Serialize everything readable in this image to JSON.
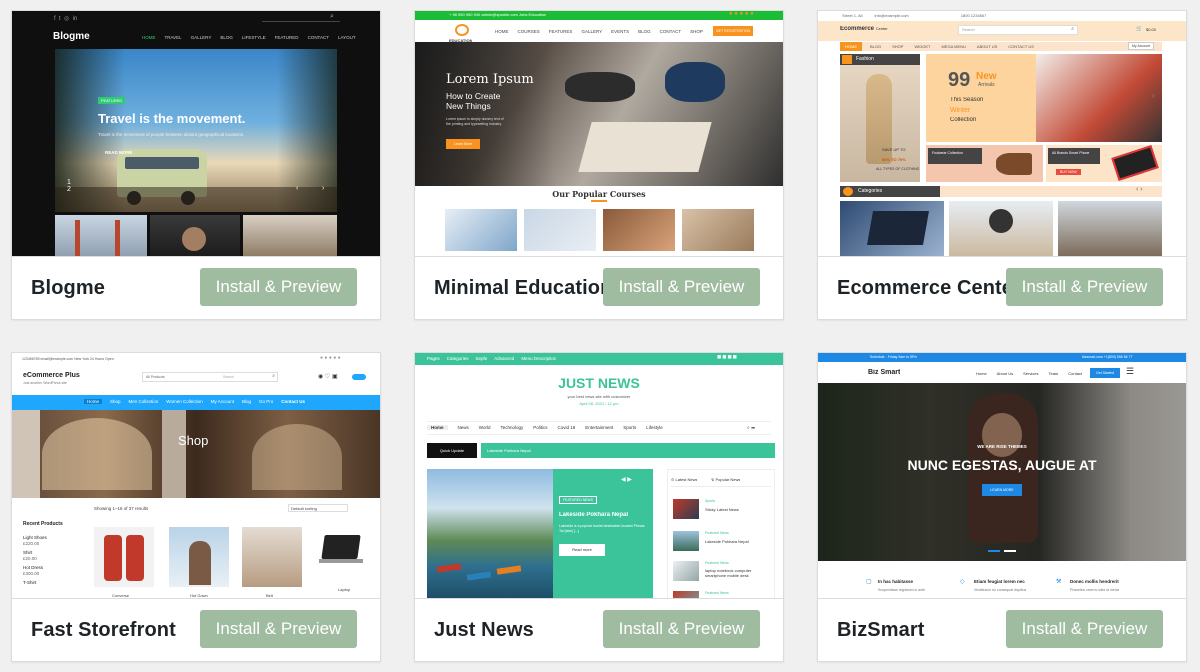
{
  "themes": [
    {
      "name": "Blogme",
      "install_label": "Install & Preview",
      "preview": {
        "logo": "Blogme",
        "nav": [
          "HOME",
          "TRAVEL",
          "GALLERY",
          "BLOG",
          "LIFESTYLE",
          "FEATURED",
          "CONTACT",
          "LAYOUT"
        ],
        "badge": "FEATURED",
        "headline": "Travel is the movement.",
        "subtext": "Travel is the movement of people between distant geographical locations.",
        "read_more": "READ MORE",
        "slide_current": "1",
        "slide_total": "2"
      }
    },
    {
      "name": "Minimal Education",
      "install_label": "Install & Preview",
      "preview": {
        "top_bar": "+ 98 950 950 940    admin@sparkle.com    Jobs    Education",
        "logo": "EDUCATION",
        "nav": [
          "HOME",
          "COURSES",
          "FEATURES",
          "GALLERY",
          "EVENTS",
          "BLOG",
          "CONTACT",
          "SHOP"
        ],
        "cta": "GET REGISTRATION",
        "hero_title": "Lorem Ipsum",
        "hero_sub1": "How to Create",
        "hero_sub2": "New Things",
        "hero_body": "Lorem ipsum is simply dummy text of the printing and typesetting industry.",
        "hero_btn": "Learn More",
        "section_title": "Our Popular Courses"
      }
    },
    {
      "name": "Ecommerce Center",
      "install_label": "Install & Preview",
      "preview": {
        "top_left": "Street 1, All",
        "top_email": "info@example.com",
        "top_phone": "1800 1234567",
        "logo": "Ecommerce",
        "logo_sub": "Center",
        "search_placeholder": "Search",
        "cart_amount": "$0.00",
        "nav": [
          "HOME",
          "BLOG",
          "SHOP",
          "WIDGET",
          "MEGA MENU",
          "ABOUT US",
          "CONTACT US"
        ],
        "account": "My Account",
        "sidebar_cat": "Fashion",
        "promo_big": "99",
        "promo_new": "New",
        "promo_arrivals": "Arrivals",
        "promo_line1": "This Season",
        "promo_line2": "Winter",
        "promo_line3": "Collection",
        "save_up": "SAVE UP TO",
        "save_pct": "50% TO 70%",
        "save_types": "ALL TYPES OF CLOTHING",
        "footwear": "Footwear Collection",
        "brands": "All Brands Smart Phone",
        "buy_now": "BUY NOW",
        "categories": "Categories"
      }
    },
    {
      "name": "Fast Storefront",
      "install_label": "Install & Preview",
      "preview": {
        "top_bar": "123456789    email@example.com    New York    24 Hours Open",
        "logo": "eCommerce Plus",
        "tagline": "Just another WordPress site",
        "all_products": "All Products",
        "search_placeholder": "Search",
        "nav": [
          "Home",
          "Shop",
          "Men Collection",
          "Women Collection",
          "My Account",
          "Blog",
          "Go Pro",
          "Contact Us"
        ],
        "hero_word": "Shop",
        "showing": "Showing 1–16 of 37 results",
        "sorting": "Default sorting",
        "sidebar_title": "Recent Products",
        "recent": [
          {
            "name": "Light Shoes",
            "price": "£220.00"
          },
          {
            "name": "Shirt",
            "price": "£20.00"
          },
          {
            "name": "Hot Dress",
            "price": "£300.00"
          },
          {
            "name": "T-Shirt",
            "price": ""
          }
        ],
        "product_labels": [
          "Converse",
          "Hot Gown",
          "Belt",
          "Laptop"
        ]
      }
    },
    {
      "name": "Just News",
      "install_label": "Install & Preview",
      "preview": {
        "top_nav": [
          "Pages",
          "Categories",
          "Sepfe",
          "Advanced",
          "Menu Description"
        ],
        "logo": "JUST NEWS",
        "tagline": "your best news site with customizer",
        "date": "April 08, 2021 / 12 pm",
        "nav": [
          "Home",
          "News",
          "World",
          "Technology",
          "Politics",
          "Covid 19",
          "Entertainment",
          "Sports",
          "Lifestyle"
        ],
        "quick_update": "Quick Update",
        "ticker": "Lakeside Pokhara Nepal",
        "badge": "FEATURED NEWS",
        "feature_title": "Lakeside Pokhara Nepal",
        "feature_body": "Lakeside is a popular tourist destination located Phewa Tal (lake) [...]",
        "read_more": "Read more",
        "tab_latest": "Latest News",
        "tab_popular": "Popular News",
        "side_items": [
          {
            "cat": "Sports",
            "title": "Sticky Latest News"
          },
          {
            "cat": "Featured News",
            "title": "Lakeside Pokhara Nepal"
          },
          {
            "cat": "Featured News",
            "title": "laptop notebook computer smartphone mobile desk"
          },
          {
            "cat": "Featured News",
            "title": ""
          }
        ]
      }
    },
    {
      "name": "BizSmart",
      "install_label": "Install & Preview",
      "preview": {
        "top_left": "Schedule - Friday 9am to 5Pm",
        "top_right": "bizsmart.com  +1(800) 555 66 77",
        "logo": "Biz Smart",
        "nav": [
          "Home",
          "About Us",
          "Services",
          "Team",
          "Contact"
        ],
        "cta": "Get Started",
        "kicker": "WE ARE RISE THEMES",
        "headline": "NUNC EGESTAS, AUGUE AT",
        "hero_btn": "LEARN MORE",
        "features": [
          {
            "title": "In hac habitasse",
            "body": "Suspendisse dignissim in ante"
          },
          {
            "title": "Etiam feugiat lorem nec",
            "body": "Vestibulum eu consequat dapibus"
          },
          {
            "title": "Donec mollis hendrerit",
            "body": "Phasellus viverra nulla ut metus"
          }
        ]
      }
    }
  ],
  "colors": {
    "install_button": "#9fbca0",
    "blogme_bg": "#0f0f0f",
    "education_green": "#1bbd36",
    "education_orange": "#f7931e",
    "ecommerce_orange": "#f7941d",
    "storefront_blue": "#1ea7fd",
    "justnews_green": "#3bc49a",
    "bizsmart_blue": "#1e88e5"
  }
}
